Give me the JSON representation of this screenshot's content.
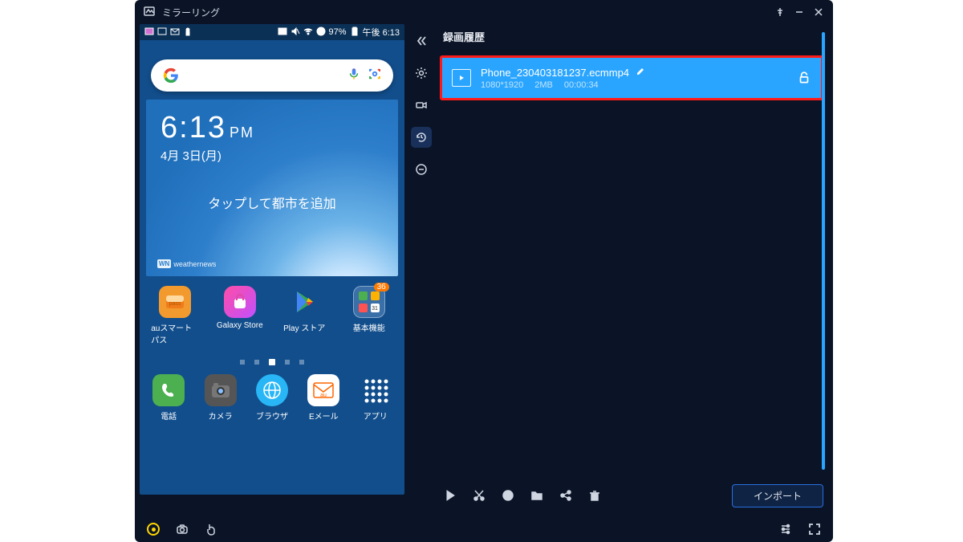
{
  "window": {
    "title": "ミラーリング"
  },
  "phone": {
    "status": {
      "battery": "97%",
      "time": "午後 6:13"
    },
    "clock": {
      "time": "6:13",
      "ampm": "PM",
      "date": "4月 3日(月)"
    },
    "weather": {
      "tap_city": "タップして都市を追加",
      "brand": "weathernews",
      "brand_short": "WN"
    },
    "apps_row1": [
      {
        "label": "auスマートパス",
        "sub": "pass"
      },
      {
        "label": "Galaxy Store"
      },
      {
        "label": "Play ストア"
      },
      {
        "label": "基本機能",
        "badge": "36",
        "sub": "31"
      }
    ],
    "dock": [
      {
        "label": "電話"
      },
      {
        "label": "カメラ"
      },
      {
        "label": "ブラウザ"
      },
      {
        "label": "Eメール",
        "sub": "au"
      },
      {
        "label": "アプリ"
      }
    ]
  },
  "panel": {
    "heading": "録画履歴",
    "record": {
      "name": "Phone_230403181237.ecmmp4",
      "resolution": "1080*1920",
      "size": "2MB",
      "duration": "00:00:34"
    },
    "import_label": "インポート"
  }
}
